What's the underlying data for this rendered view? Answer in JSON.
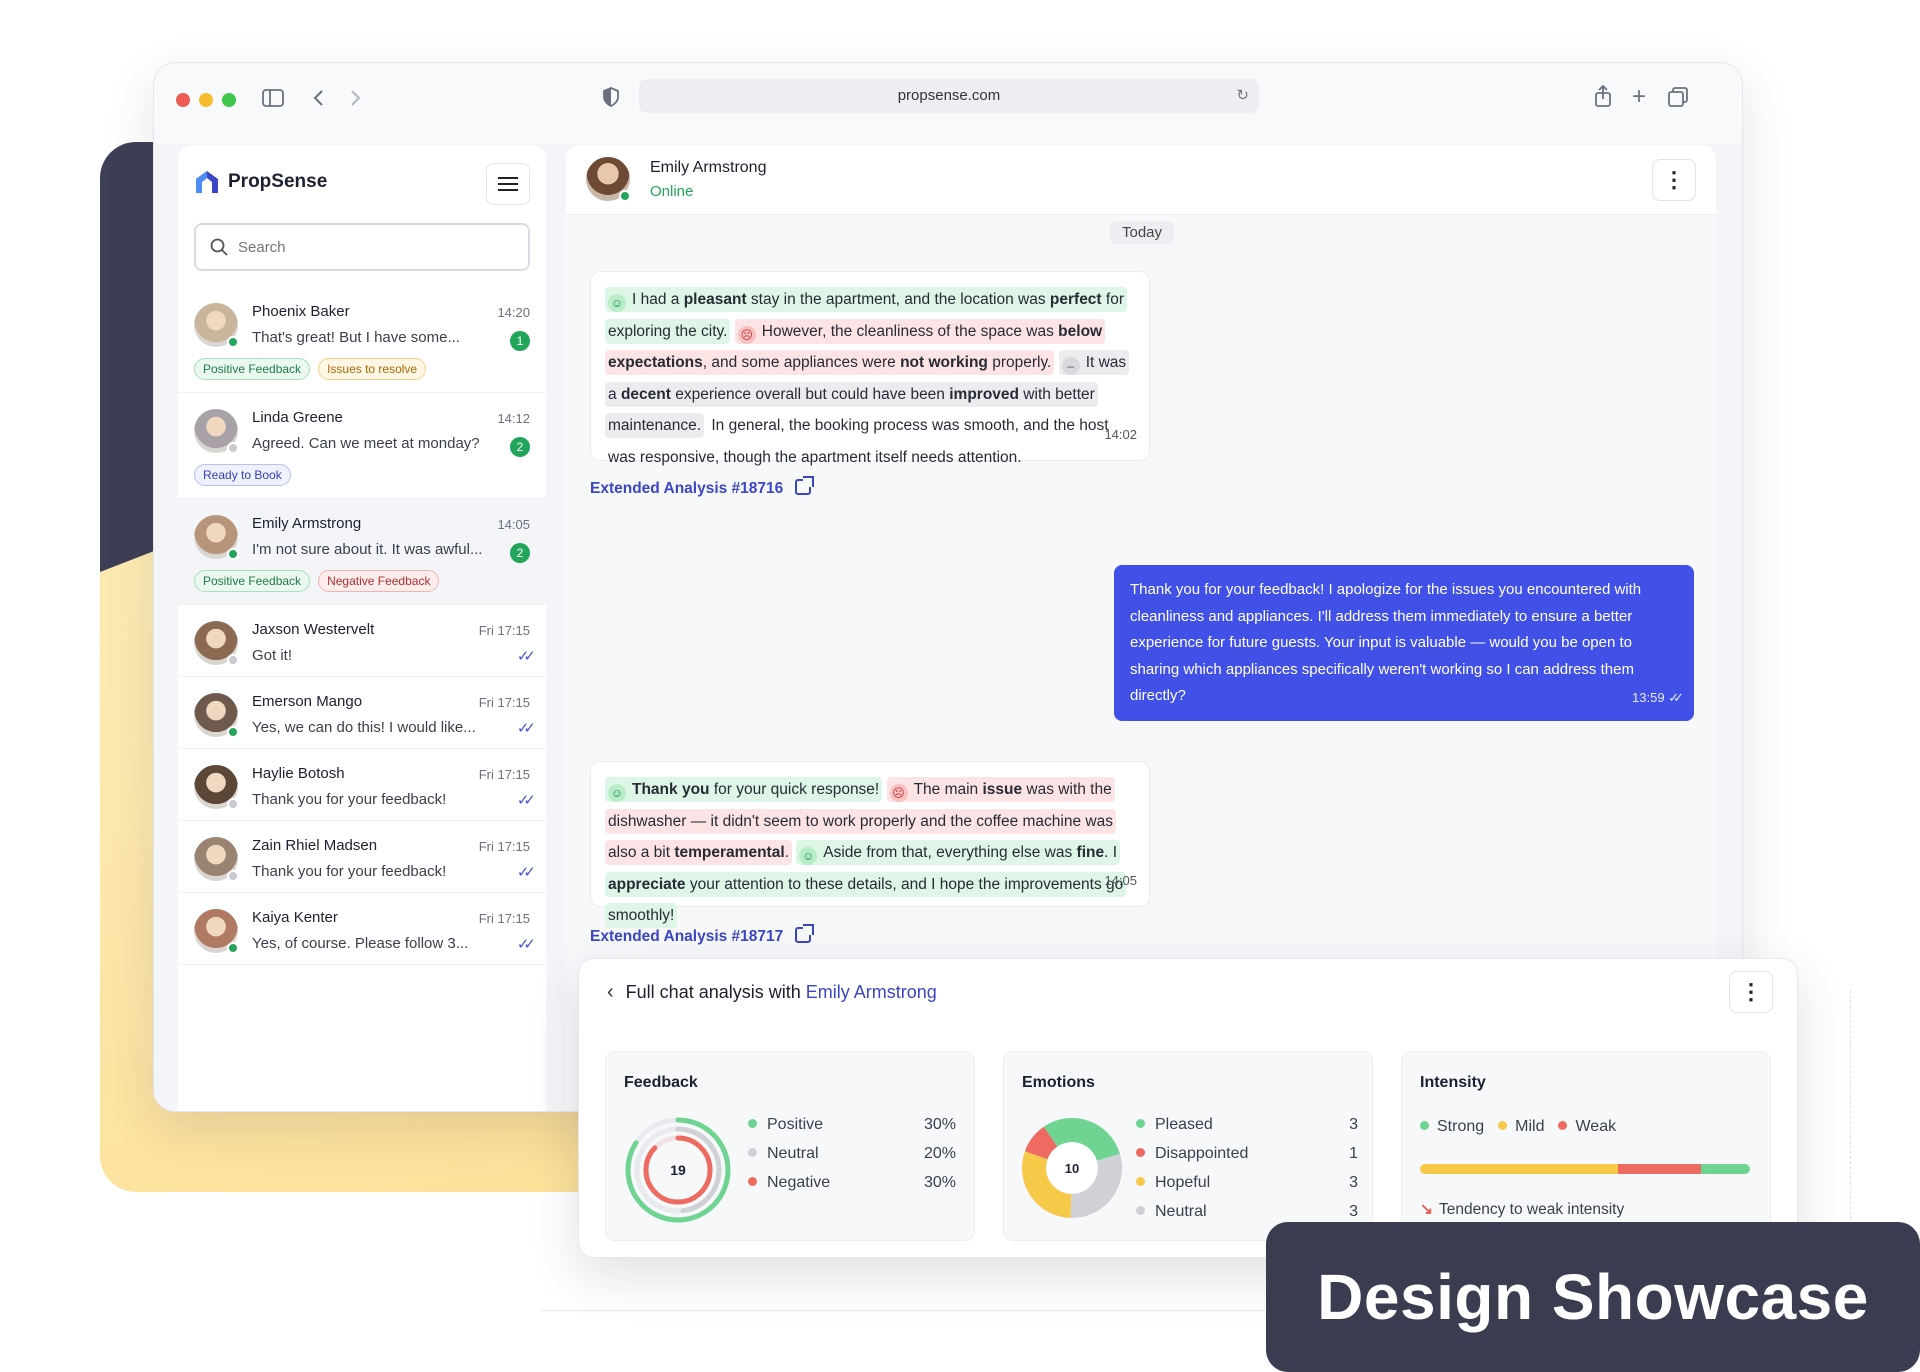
{
  "browser": {
    "url": "propsense.com",
    "traffic_lights": [
      "#ee5c55",
      "#f5bd2e",
      "#3ec54a"
    ]
  },
  "sidebar": {
    "brand": "PropSense",
    "search_placeholder": "Search",
    "conversations": [
      {
        "name": "Phoenix Baker",
        "time": "14:20",
        "preview": "That's great! But I have some...",
        "unread": "1",
        "online": true,
        "tags": [
          {
            "label": "Positive Feedback",
            "kind": "pos"
          },
          {
            "label": "Issues to resolve",
            "kind": "res"
          }
        ],
        "avatar_color": "#c9b59c"
      },
      {
        "name": "Linda Greene",
        "time": "14:12",
        "preview": "Agreed. Can we meet at monday?",
        "unread": "2",
        "online": false,
        "tags": [
          {
            "label": "Ready to Book",
            "kind": "book"
          }
        ],
        "avatar_color": "#a9a1a8"
      },
      {
        "name": "Emily Armstrong",
        "time": "14:05",
        "preview": "I'm not sure about it. It was awful...",
        "unread": "2",
        "online": true,
        "active": true,
        "tags": [
          {
            "label": "Positive Feedback",
            "kind": "pos"
          },
          {
            "label": "Negative Feedback",
            "kind": "neg"
          }
        ],
        "avatar_color": "#b7957a"
      },
      {
        "name": "Jaxson Westervelt",
        "time": "Fri 17:15",
        "preview": "Got it!",
        "read": true,
        "online": false,
        "tags": [],
        "avatar_color": "#8c6a52"
      },
      {
        "name": "Emerson Mango",
        "time": "Fri 17:15",
        "preview": "Yes, we can do this! I would like...",
        "read": true,
        "online": true,
        "tags": [],
        "avatar_color": "#6d5a4c"
      },
      {
        "name": "Haylie Botosh",
        "time": "Fri 17:15",
        "preview": "Thank you for your feedback!",
        "read": true,
        "online": false,
        "tags": [],
        "avatar_color": "#5c4638"
      },
      {
        "name": "Zain Rhiel Madsen",
        "time": "Fri 17:15",
        "preview": "Thank you for your feedback!",
        "read": true,
        "online": false,
        "tags": [],
        "avatar_color": "#9a8370"
      },
      {
        "name": "Kaiya Kenter",
        "time": "Fri 17:15",
        "preview": "Yes, of course. Please follow 3...",
        "read": true,
        "online": true,
        "tags": [],
        "avatar_color": "#b07a62"
      }
    ]
  },
  "chat": {
    "contact_name": "Emily Armstrong",
    "contact_status": "Online",
    "day_label": "Today",
    "message1": {
      "time": "14:02",
      "segments": [
        {
          "sentiment": "p",
          "emoji": true,
          "parts": [
            [
              "I had a ",
              false
            ],
            [
              "pleasant",
              true
            ],
            [
              " stay in the apartment, and the location was ",
              false
            ],
            [
              "perfect",
              true
            ],
            [
              " for exploring the city.",
              false
            ]
          ]
        },
        {
          "sentiment": "n",
          "emoji": true,
          "parts": [
            [
              "However, the cleanliness of the space was ",
              false
            ],
            [
              "below expectations",
              true
            ],
            [
              ", and some appliances were ",
              false
            ],
            [
              "not working",
              true
            ],
            [
              " properly.",
              false
            ]
          ]
        },
        {
          "sentiment": "u",
          "emoji": true,
          "parts": [
            [
              "It was a ",
              false
            ],
            [
              "decent",
              true
            ],
            [
              " experience overall but could have been ",
              false
            ],
            [
              "improved",
              true
            ],
            [
              " with better maintenance.",
              false
            ]
          ]
        },
        {
          "sentiment": "",
          "emoji": false,
          "parts": [
            [
              "In general, the booking process was smooth, and the host was responsive, though the apartment itself needs attention.",
              false
            ]
          ]
        }
      ]
    },
    "link1": "Extended Analysis #18716",
    "message2": {
      "time": "13:59",
      "text": "Thank you for your feedback!  I apologize for the issues you encountered with cleanliness and appliances. I'll address them immediately to ensure a better experience for future guests. Your input is valuable — would you be open to sharing which appliances specifically weren't working so I can address them directly?"
    },
    "message3": {
      "time": "14:05",
      "segments": [
        {
          "sentiment": "p",
          "emoji": true,
          "parts": [
            [
              "Thank you",
              true
            ],
            [
              " for your quick response!",
              false
            ]
          ]
        },
        {
          "sentiment": "n",
          "emoji": true,
          "parts": [
            [
              "The main ",
              false
            ],
            [
              "issue",
              true
            ],
            [
              " was with the dishwasher — it didn't seem to work properly and the coffee machine was also a bit ",
              false
            ],
            [
              "temperamental",
              true
            ],
            [
              ".",
              false
            ]
          ]
        },
        {
          "sentiment": "p",
          "emoji": true,
          "parts": [
            [
              "Aside from that, everything else was ",
              false
            ],
            [
              "fine",
              true
            ],
            [
              ". I ",
              false
            ],
            [
              "appreciate",
              true
            ],
            [
              " your attention to these details, and I hope the improvements go smoothly!",
              false
            ]
          ]
        }
      ]
    },
    "link2": "Extended Analysis #18717"
  },
  "analysis": {
    "title_prefix": "Full chat analysis with",
    "title_name": "Emily Armstrong",
    "feedback": {
      "title": "Feedback",
      "total": "19",
      "items": [
        {
          "label": "Positive",
          "value": "30%",
          "color": "#6fd392"
        },
        {
          "label": "Neutral",
          "value": "20%",
          "color": "#cfd1d6"
        },
        {
          "label": "Negative",
          "value": "30%",
          "color": "#ee6b62"
        }
      ]
    },
    "emotions": {
      "title": "Emotions",
      "total": "10",
      "items": [
        {
          "label": "Pleased",
          "value": "3",
          "color": "#6fd392"
        },
        {
          "label": "Disappointed",
          "value": "1",
          "color": "#ee6b62"
        },
        {
          "label": "Hopeful",
          "value": "3",
          "color": "#f7c948"
        },
        {
          "label": "Neutral",
          "value": "3",
          "color": "#cfd1d6"
        }
      ]
    },
    "intensity": {
      "title": "Intensity",
      "legend": [
        {
          "label": "Strong",
          "color": "#6fd392"
        },
        {
          "label": "Mild",
          "color": "#f7c948"
        },
        {
          "label": "Weak",
          "color": "#ee6b62"
        }
      ],
      "bar": [
        {
          "color": "#f7c948",
          "fraction": 0.6
        },
        {
          "color": "#ee6b62",
          "fraction": 0.25
        },
        {
          "color": "#6fd392",
          "fraction": 0.15
        }
      ],
      "tendency": "Tendency to weak intensity"
    }
  },
  "showcase_label": "Design Showcase"
}
